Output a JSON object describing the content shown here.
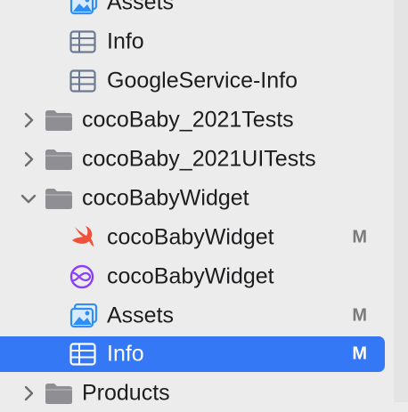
{
  "navigator": {
    "items": [
      {
        "label": "Assets",
        "status": ""
      },
      {
        "label": "Info",
        "status": ""
      },
      {
        "label": "GoogleService-Info",
        "status": ""
      },
      {
        "label": "cocoBaby_2021Tests",
        "status": ""
      },
      {
        "label": "cocoBaby_2021UITests",
        "status": ""
      },
      {
        "label": "cocoBabyWidget",
        "status": ""
      },
      {
        "label": "cocoBabyWidget",
        "status": "M"
      },
      {
        "label": "cocoBabyWidget",
        "status": ""
      },
      {
        "label": "Assets",
        "status": "M"
      },
      {
        "label": "Info",
        "status": "M"
      },
      {
        "label": "Products",
        "status": ""
      }
    ]
  },
  "colors": {
    "selection": "#3478f6",
    "folder": "#8e8e93",
    "table_icon": "#6b7a90",
    "swift": "#f05138",
    "intent": "#8a3ffc",
    "assets": "#2f8ff7"
  }
}
